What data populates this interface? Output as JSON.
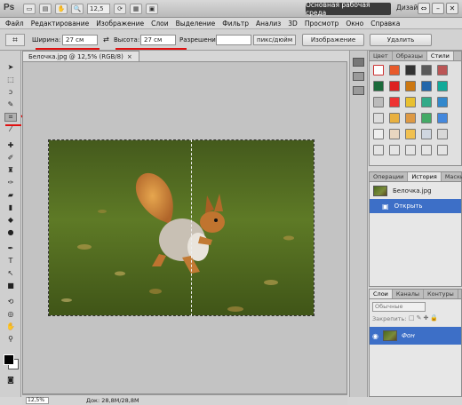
{
  "titlebar": {
    "logo": "Ps",
    "zoom": "12,5",
    "workspace": "Основная рабочая среда",
    "design": "Дизайн",
    "window_buttons": [
      "⇔",
      "–",
      "□",
      "✕"
    ]
  },
  "menu": [
    "Файл",
    "Редактирование",
    "Изображение",
    "Слои",
    "Выделение",
    "Фильтр",
    "Анализ",
    "3D",
    "Просмотр",
    "Окно",
    "Справка"
  ],
  "options": {
    "width_label": "Ширина:",
    "width_value": "27 см",
    "swap": "⇄",
    "height_label": "Высота:",
    "height_value": "27 см",
    "resolution_label": "Разрешение:",
    "resolution_value": "",
    "resolution_unit": "пикс/дюйм",
    "image_button": "Изображение",
    "clear_button": "Удалить"
  },
  "document": {
    "tab_title": "Белочка.jpg @ 12,5% (RGB/8)",
    "tab_close": "×",
    "status_zoom": "12,5%",
    "status_doc": "Док: 28,8M/28,8M"
  },
  "styles_panel": {
    "tabs": [
      "Цвет",
      "Образцы",
      "Стили"
    ],
    "active_tab": 2
  },
  "history_panel": {
    "tabs": [
      "Операции",
      "История",
      "Маски"
    ],
    "active_tab": 1,
    "snapshot": "Белочка.jpg",
    "items": [
      "Открыть"
    ]
  },
  "layers_panel": {
    "tabs": [
      "Слои",
      "Каналы",
      "Контуры"
    ],
    "active_tab": 0,
    "blend_mode": "Обычные",
    "lock_label": "Закрепить:",
    "layer_name": "Фон"
  },
  "colors": {
    "accent": "#3d6fc7",
    "annotation": "#e01010"
  }
}
